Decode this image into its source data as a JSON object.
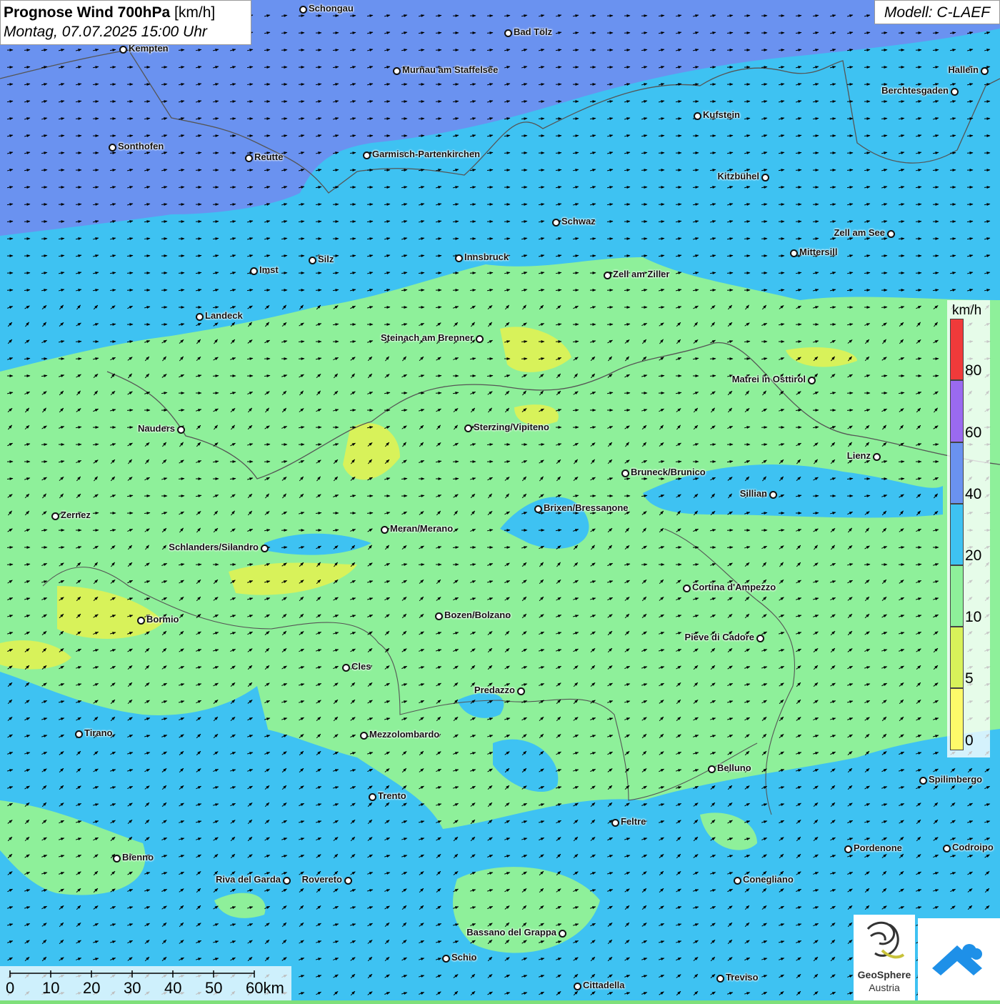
{
  "header": {
    "title_bold": "Prognose Wind 700hPa",
    "title_unit": "[km/h]",
    "date_time": "Montag, 07.07.2025 15:00 Uhr",
    "model": "Modell: C-LAEF"
  },
  "legend": {
    "unit": "km/h",
    "labels": [
      "80",
      "60",
      "40",
      "20",
      "10",
      "5",
      "0"
    ],
    "colors": {
      "band_0_5": "#fdfa6a",
      "band_5_10": "#d8f25a",
      "band_10_20": "#8ef09a",
      "band_20_40": "#3ec2f2",
      "band_40_60": "#6a92f0",
      "band_60_80": "#9a6af0",
      "band_80_plus": "#f03a3a"
    }
  },
  "scale_bar": {
    "labels": [
      "0",
      "10",
      "20",
      "30",
      "40",
      "50",
      "60km"
    ]
  },
  "logos": {
    "geosphere_name": "GeoSphere",
    "geosphere_country": "Austria",
    "geosphere_icon": "geosphere-logo-icon",
    "app_icon": "weather-app-icon"
  },
  "cities": [
    {
      "name": "Schongau"
    },
    {
      "name": "Kempten"
    },
    {
      "name": "Bad Tölz"
    },
    {
      "name": "Murnau am Staffelsee"
    },
    {
      "name": "Hallein"
    },
    {
      "name": "Berchtesgaden"
    },
    {
      "name": "Kufstein"
    },
    {
      "name": "Sonthofen"
    },
    {
      "name": "Reutte"
    },
    {
      "name": "Garmisch-Partenkirchen"
    },
    {
      "name": "Kitzbühel"
    },
    {
      "name": "Schwaz"
    },
    {
      "name": "Zell am See"
    },
    {
      "name": "Mittersill"
    },
    {
      "name": "Innsbruck"
    },
    {
      "name": "Imst"
    },
    {
      "name": "Silz"
    },
    {
      "name": "Zell am Ziller"
    },
    {
      "name": "Landeck"
    },
    {
      "name": "Steinach am Brenner"
    },
    {
      "name": "Matrei in Osttirol"
    },
    {
      "name": "Nauders"
    },
    {
      "name": "Sterzing/Vipiteno"
    },
    {
      "name": "Lienz"
    },
    {
      "name": "Bruneck/Brunico"
    },
    {
      "name": "Sillian"
    },
    {
      "name": "Brixen/Bressanone"
    },
    {
      "name": "Zernez"
    },
    {
      "name": "Meran/Merano"
    },
    {
      "name": "Schlanders/Silandro"
    },
    {
      "name": "Cortina d'Ampezzo"
    },
    {
      "name": "Bozen/Bolzano"
    },
    {
      "name": "Bormio"
    },
    {
      "name": "Pieve di Cadore"
    },
    {
      "name": "Cles"
    },
    {
      "name": "Predazzo"
    },
    {
      "name": "Tirano"
    },
    {
      "name": "Mezzolombardo"
    },
    {
      "name": "Belluno"
    },
    {
      "name": "Spilimbergo"
    },
    {
      "name": "Trento"
    },
    {
      "name": "Feltre"
    },
    {
      "name": "Bienno"
    },
    {
      "name": "Pordenone"
    },
    {
      "name": "Codroipo"
    },
    {
      "name": "Riva del Garda"
    },
    {
      "name": "Rovereto"
    },
    {
      "name": "Conegliano"
    },
    {
      "name": "Bassano del Grappa"
    },
    {
      "name": "Schio"
    },
    {
      "name": "Treviso"
    },
    {
      "name": "Cittadella"
    }
  ]
}
